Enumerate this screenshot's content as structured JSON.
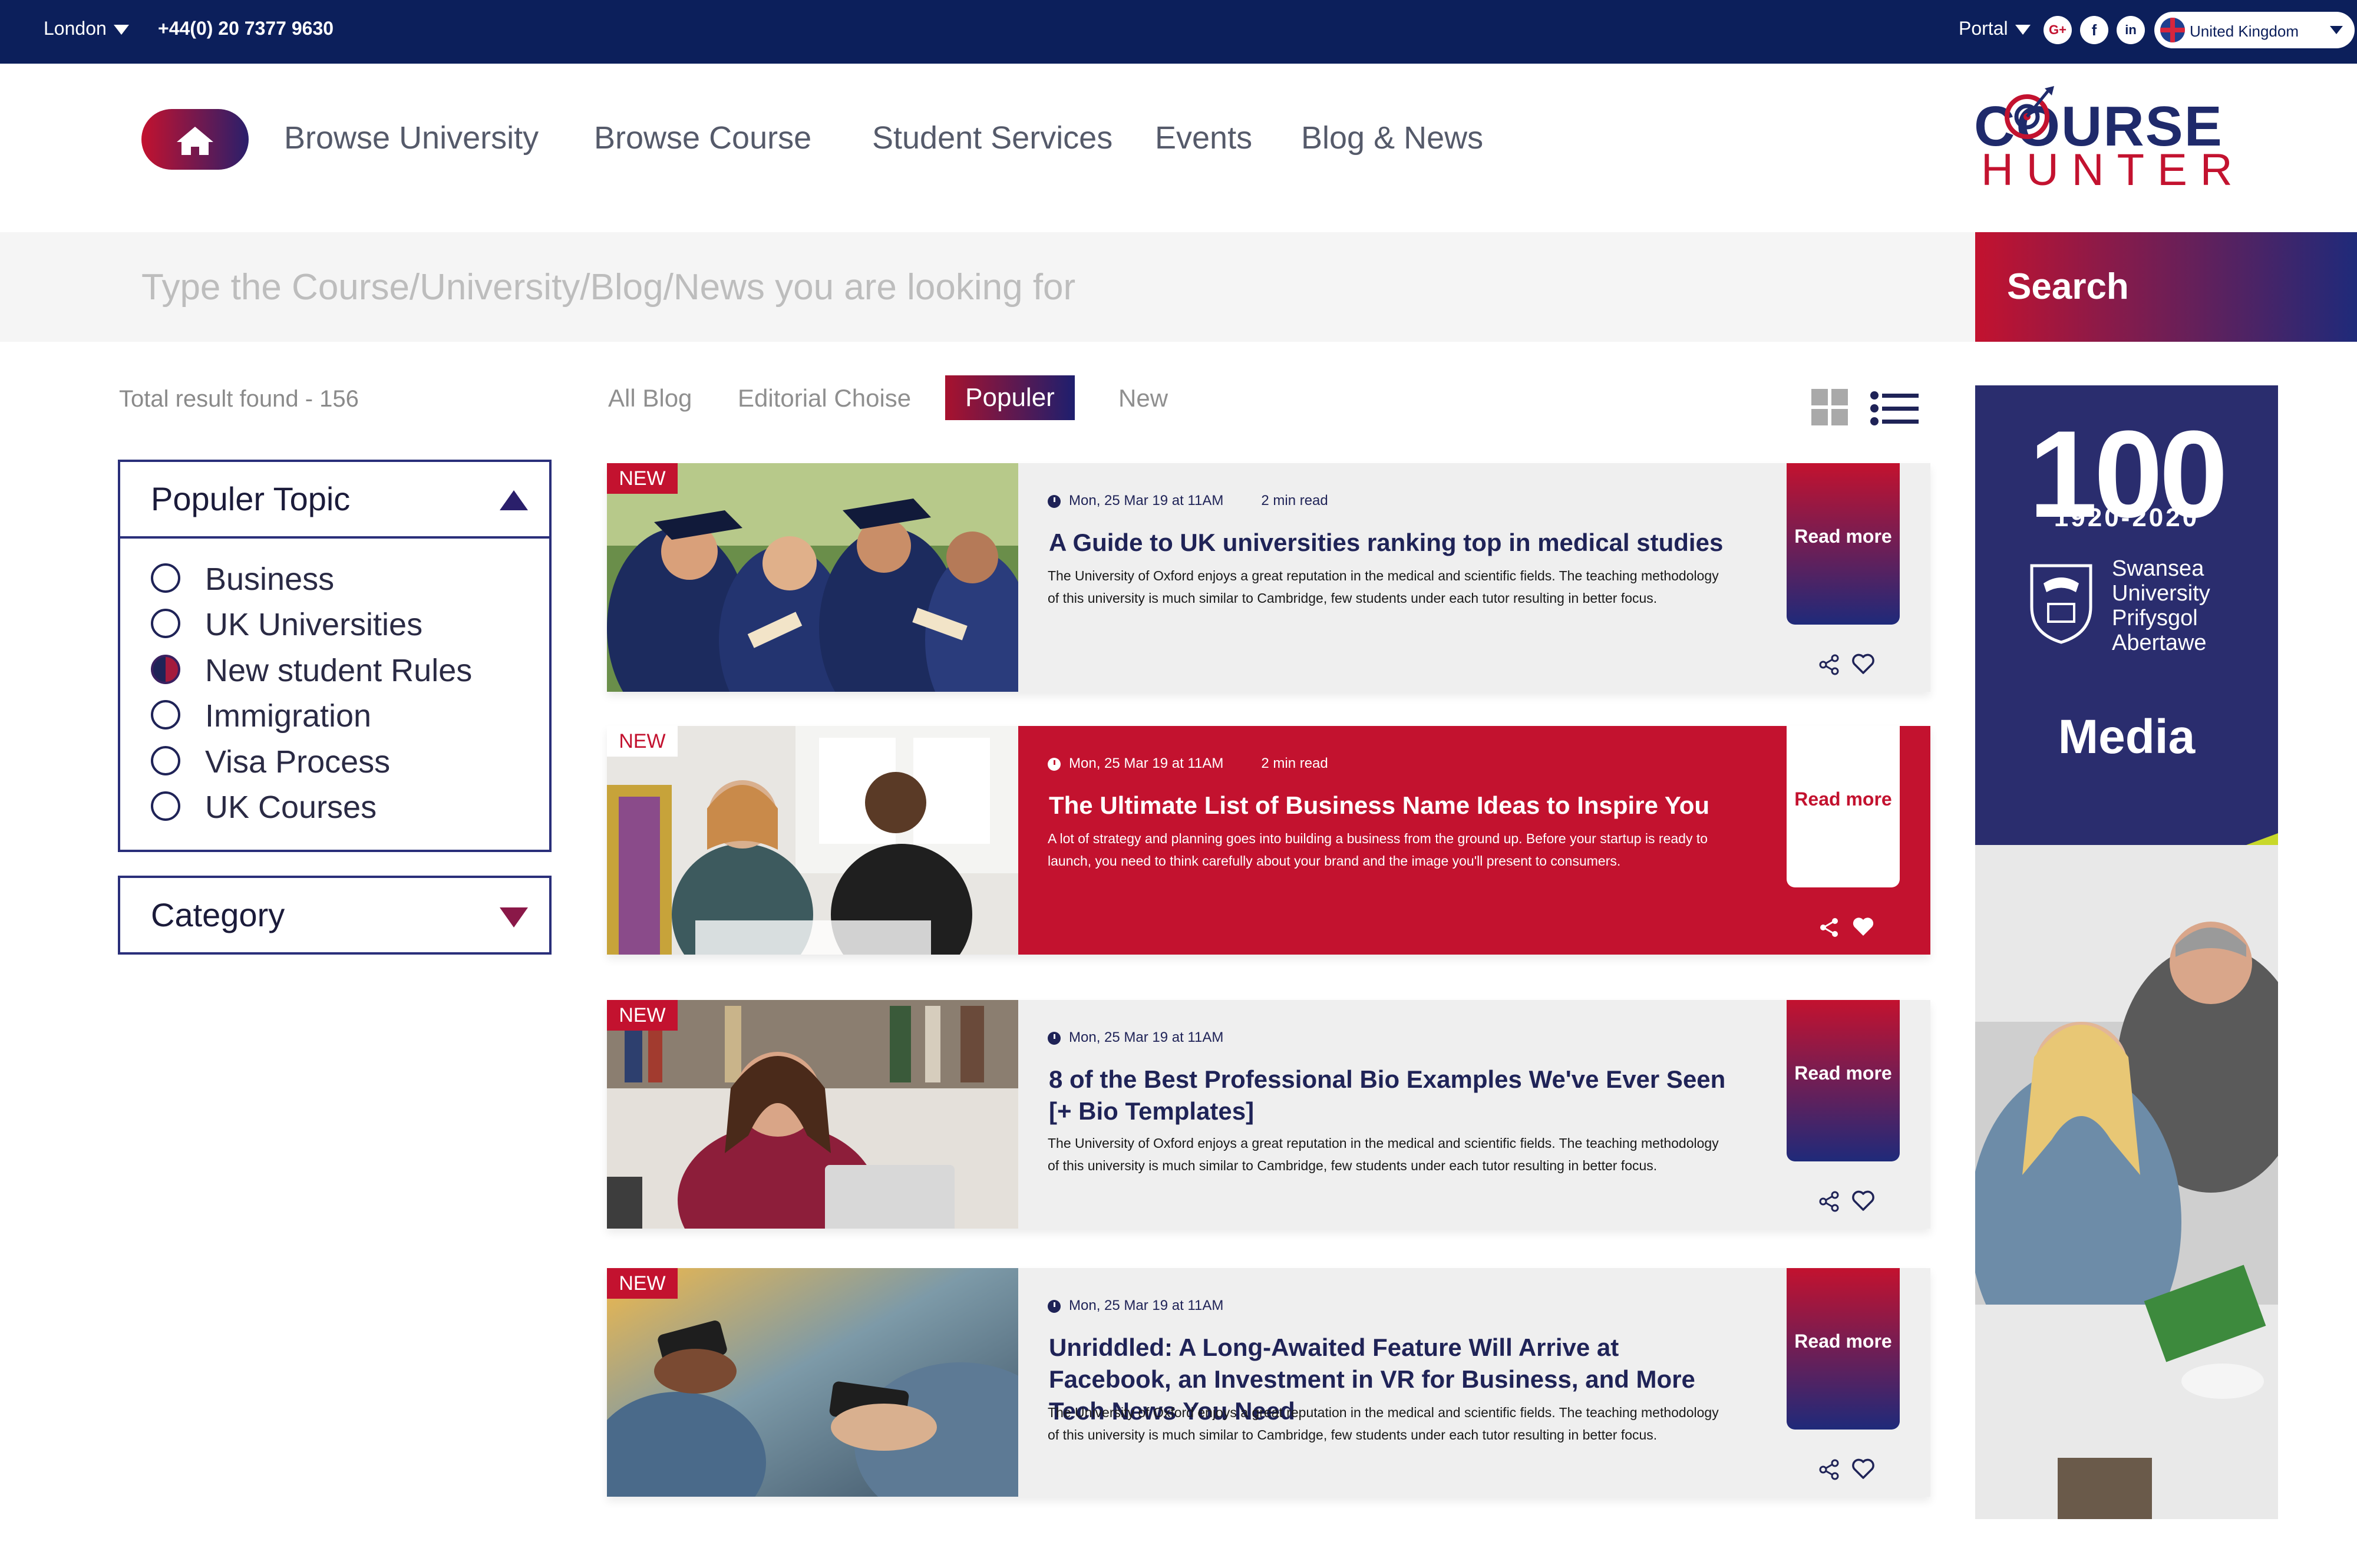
{
  "topbar": {
    "city": "London",
    "phone": "+44(0) 20 7377 9630",
    "portal": "Portal",
    "social": [
      "G+",
      "f",
      "in"
    ],
    "country": "United Kingdom"
  },
  "nav": {
    "home_icon": "home-icon",
    "items": [
      "Browse University",
      "Browse Course",
      "Student Services",
      "Events",
      "Blog & News"
    ]
  },
  "logo": {
    "line1": "COURSE",
    "line2": "HUNTER"
  },
  "search": {
    "placeholder": "Type the Course/University/Blog/News you are looking for",
    "button": "Search"
  },
  "results": {
    "total_text": "Total result found - 156"
  },
  "filters": {
    "topic_title": "Populer Topic",
    "topics": [
      {
        "label": "Business",
        "selected": false
      },
      {
        "label": "UK Universities",
        "selected": false
      },
      {
        "label": "New student Rules",
        "selected": true
      },
      {
        "label": "Immigration",
        "selected": false
      },
      {
        "label": "Visa Process",
        "selected": false
      },
      {
        "label": "UK Courses",
        "selected": false
      }
    ],
    "category_title": "Category"
  },
  "tabs": [
    "All Blog",
    "Editorial Choise",
    "Populer",
    "New"
  ],
  "active_tab": "Populer",
  "cards": [
    {
      "badge": "NEW",
      "date": "Mon, 25 Mar 19 at 11AM",
      "read_time": "2 min read",
      "title": "A Guide to UK universities ranking top in medical studies",
      "excerpt": "The University of Oxford enjoys a great reputation in the medical and scientific fields. The teaching methodology of this university is much similar to Cambridge, few students under each tutor resulting in better focus.",
      "read_more": "Read more"
    },
    {
      "badge": "NEW",
      "date": "Mon, 25 Mar 19 at 11AM",
      "read_time": "2 min read",
      "title": "The Ultimate List of Business Name Ideas to Inspire You",
      "excerpt": "A lot of strategy and planning goes into building a business from the ground up. Before your startup is ready to launch, you need to think carefully about your brand and the image you'll present to consumers.",
      "read_more": "Read more"
    },
    {
      "badge": "NEW",
      "date": "Mon, 25 Mar 19 at 11AM",
      "read_time": "",
      "title": "8 of the Best Professional Bio Examples We've Ever Seen [+ Bio Templates]",
      "excerpt": "The University of Oxford enjoys a great reputation in the medical and scientific fields. The teaching methodology of this university is much similar to Cambridge, few students under each tutor resulting in better focus.",
      "read_more": "Read more"
    },
    {
      "badge": "NEW",
      "date": "Mon, 25 Mar 19 at 11AM",
      "read_time": "",
      "title": "Unriddled: A Long-Awaited Feature Will Arrive at Facebook, an Investment in VR for Business, and More Tech News You Need",
      "excerpt": "The University of Oxford enjoys a great reputation in the medical and scientific fields. The teaching methodology of this university is much similar to Cambridge, few students under each tutor resulting in better focus.",
      "read_more": "Read more"
    }
  ],
  "ad": {
    "number": "100",
    "years": "1920-2020",
    "university_lines": [
      "Swansea",
      "University",
      "Prifysgol",
      "Abertawe"
    ],
    "tagline": "Media"
  },
  "colors": {
    "navy": "#0c1f5b",
    "brand_red": "#c3122f",
    "brand_indigo": "#1f2a7a",
    "ad_lime": "#c8d82a"
  }
}
